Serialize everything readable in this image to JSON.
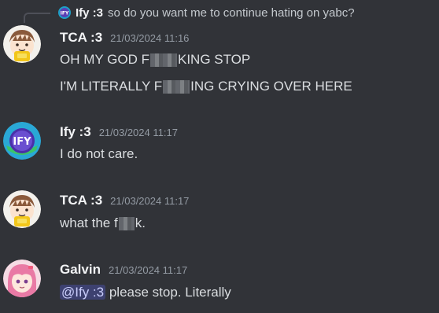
{
  "reply": {
    "author": "Ify :3",
    "text": "so do you want me to continue hating on yabc?"
  },
  "messages": [
    {
      "author": "TCA :3",
      "timestamp": "21/03/2024 11:16",
      "line1_before": "OH MY GOD F",
      "line1_after": "KING STOP",
      "line2_before": "I'M LITERALLY F",
      "line2_after": "ING CRYING OVER HERE"
    },
    {
      "author": "Ify :3",
      "timestamp": "21/03/2024 11:17",
      "text": "I do not care.",
      "avatar_text": "IFY"
    },
    {
      "author": "TCA :3",
      "timestamp": "21/03/2024 11:17",
      "text_before": "what the f",
      "text_after": "k."
    },
    {
      "author": "Galvin",
      "timestamp": "21/03/2024 11:17",
      "mention": "@Ify :3",
      "text": " please stop. Literally"
    }
  ],
  "colors": {
    "background": "#313338",
    "author": "#f2f3f5",
    "message_text": "#dbdee1",
    "timestamp": "#949ba4",
    "mention_bg": "rgba(88,101,242,0.3)"
  }
}
